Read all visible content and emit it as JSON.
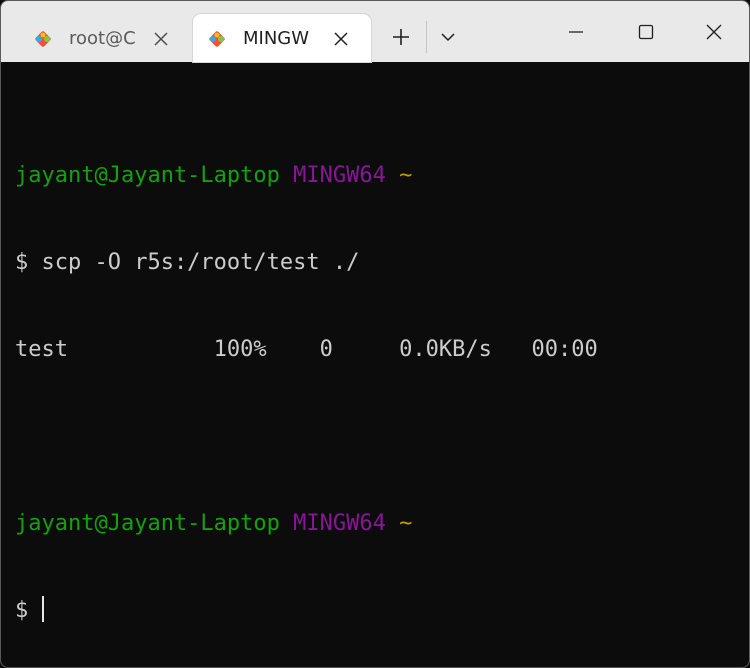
{
  "tabs": [
    {
      "label": "root@C",
      "icon": "git-icon",
      "active": false
    },
    {
      "label": "MINGW",
      "icon": "git-icon",
      "active": true
    }
  ],
  "tab_controls": {
    "new_tab_icon": "plus-icon",
    "dropdown_icon": "chevron-down-icon"
  },
  "window_controls": {
    "minimize_icon": "minimize-icon",
    "maximize_icon": "maximize-icon",
    "close_icon": "close-icon"
  },
  "terminal": {
    "prompt1": {
      "user_host": "jayant@Jayant-Laptop",
      "env": "MINGW64",
      "path": "~"
    },
    "command_line": "$ scp -O r5s:/root/test ./",
    "transfer_line": "test           100%    0     0.0KB/s   00:00",
    "prompt2": {
      "user_host": "jayant@Jayant-Laptop",
      "env": "MINGW64",
      "path": "~"
    },
    "input_line": "$ "
  },
  "colors": {
    "background": "#0c0c0c",
    "text": "#cccccc",
    "user_host": "#13a10e",
    "env": "#881798",
    "path": "#c19c00",
    "titlebar": "#e9e9e9"
  }
}
